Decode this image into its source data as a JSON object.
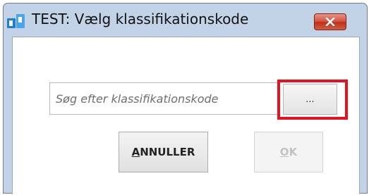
{
  "window": {
    "title": "TEST: Vælg klassifikationskode",
    "close_icon": "close-x-icon",
    "app_icon": "bp-app-logo-icon"
  },
  "search": {
    "placeholder": "Søg efter klassifikationskode",
    "value": "",
    "browse_label": "..."
  },
  "buttons": {
    "cancel": {
      "mnemonic": "A",
      "rest": "NNULLER"
    },
    "ok": {
      "mnemonic": "O",
      "rest": "K",
      "enabled": false
    }
  },
  "colors": {
    "frame": "#c3d3e7",
    "close_button": "#c73d24",
    "highlight": "#e8111b",
    "app_icon_blue": "#1e7fd0"
  }
}
